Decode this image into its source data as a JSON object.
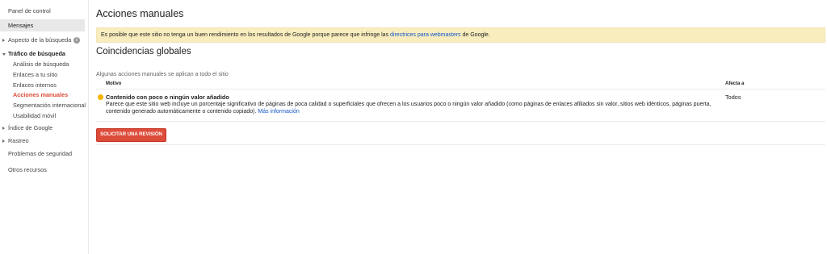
{
  "sidebar": {
    "dashboard": "Panel de control",
    "messages": "Mensajes",
    "search_appearance": "Aspecto de la búsqueda",
    "search_traffic": "Tráfico de búsqueda",
    "search_analytics": "Análisis de búsqueda",
    "links_to_site": "Enlaces a tu sitio",
    "internal_links": "Enlaces internos",
    "manual_actions": "Acciones manuales",
    "international_targeting": "Segmentación internacional",
    "mobile_usability": "Usabilidad móvil",
    "google_index": "Índice de Google",
    "crawl": "Rastreo",
    "security_issues": "Problemas de seguridad",
    "other_resources": "Otros recursos"
  },
  "main": {
    "title": "Acciones manuales",
    "warning_before": "Es posible que este sitio no tenga un buen rendimiento en los resultados de Google porque parece que infringe las ",
    "warning_link": "directrices para webmasters",
    "warning_after": " de Google.",
    "section_title": "Coincidencias globales",
    "section_subtitle": "Algunas acciones manuales se aplican a todo el sitio",
    "col_reason": "Motivo",
    "col_affects": "Afecta a",
    "reason_title": "Contenido con poco o ningún valor añadido",
    "reason_desc": "Parece que este sitio web incluye un porcentaje significativo de páginas de poca calidad o superficiales que ofrecen a los usuarios poco o ningún valor añadido (como páginas de enlaces afiliados sin valor, sitios web idénticos, páginas puerta, contenido generado automáticamente o contenido copiado).",
    "more_info": "Más información",
    "affects_value": "Todos",
    "review_button": "SOLICITAR UNA REVISIÓN"
  },
  "colors": {
    "accent_red": "#dd4b39",
    "link_blue": "#1155cc",
    "warning_bg": "#f9edbe",
    "warn_icon": "#f4b400"
  }
}
